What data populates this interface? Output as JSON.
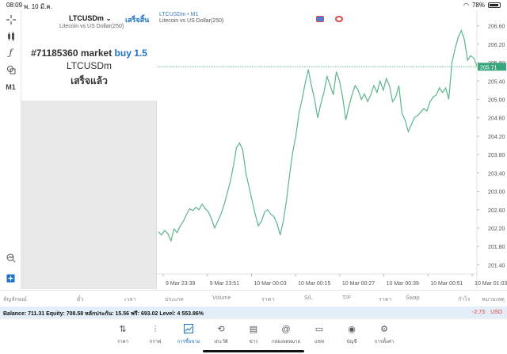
{
  "status": {
    "time": "08:09",
    "date": "พ. 10 มี.ค.",
    "battery": "78%"
  },
  "left_toolbar": {
    "timeframe": "M1",
    "tools": [
      "crosshair-icon",
      "indicators-icon",
      "function-icon",
      "objects-icon",
      "timeframe-label",
      "zoom-icon",
      "add-icon"
    ]
  },
  "trade": {
    "symbol": "LTCUSDm",
    "description": "Litecoin vs US Dollar(250)",
    "done_label": "เสร็จสิ้น",
    "order_prefix": "#71185360 market",
    "order_action": "buy 1.5",
    "order_symbol": "LTCUSDm",
    "order_status": "เสร็จแล้ว"
  },
  "chart": {
    "title": "LTCUSDm • M1",
    "subtitle": "Litecoin vs US Dollar(250)",
    "current_price_label": "205.71",
    "line_color": "#5bb58c",
    "price_line_color": "#3aa67d"
  },
  "chart_data": {
    "type": "line",
    "x_ticks": [
      "9 Mar 23:39",
      "9 Mar 23:51",
      "10 Mar 00:03",
      "10 Mar 00:15",
      "10 Mar 00:27",
      "10 Mar 00:39",
      "10 Mar 00:51",
      "10 Mar 01:03"
    ],
    "y_ticks": [
      "206.60",
      "206.20",
      "205.80",
      "205.40",
      "205.00",
      "204.60",
      "204.20",
      "203.80",
      "203.40",
      "203.00",
      "202.60",
      "202.20",
      "201.80",
      "201.40"
    ],
    "ylim": [
      201.2,
      206.8
    ],
    "current_price": 205.71,
    "values": [
      202.12,
      202.05,
      202.15,
      202.08,
      201.92,
      202.18,
      202.1,
      202.25,
      202.35,
      202.5,
      202.62,
      202.58,
      202.65,
      202.6,
      202.72,
      202.62,
      202.55,
      202.4,
      202.2,
      202.35,
      202.5,
      202.7,
      202.95,
      203.2,
      203.55,
      203.95,
      204.05,
      203.9,
      203.4,
      203.1,
      202.8,
      202.5,
      202.25,
      202.35,
      202.55,
      202.6,
      202.5,
      202.45,
      202.3,
      202.05,
      202.35,
      202.8,
      203.35,
      203.85,
      204.2,
      204.7,
      205.0,
      205.35,
      205.65,
      205.3,
      205.0,
      204.6,
      204.9,
      205.15,
      205.5,
      205.3,
      205.1,
      205.6,
      205.4,
      205.05,
      204.55,
      204.85,
      205.1,
      205.3,
      205.2,
      205.0,
      205.12,
      204.95,
      205.1,
      205.3,
      205.15,
      205.4,
      205.2,
      205.45,
      205.3,
      204.95,
      205.05,
      205.3,
      204.7,
      204.55,
      204.3,
      204.45,
      204.6,
      204.65,
      204.72,
      204.8,
      204.75,
      204.95,
      205.05,
      205.1,
      205.25,
      205.15,
      205.25,
      205.0,
      205.8,
      206.1,
      206.35,
      206.5,
      206.3,
      205.85,
      205.95,
      205.9,
      205.72
    ]
  },
  "table_header": [
    "สัญลักษณ์",
    "ตั๋ว",
    "เวลา",
    "ประเภท",
    "Volume",
    "ราคา",
    "S/L",
    "T/P",
    "ราคา",
    "Swap",
    "กำไร",
    "หมายเหตุ"
  ],
  "balance": {
    "text": "Balance: 711.31 Equity: 708.58 หลักประกัน: 15.56 ฟรี: 693.02 Level: 4 553.86%",
    "pl": "-2.73",
    "currency": "USD"
  },
  "nav": [
    {
      "icon": "quotes-icon",
      "label": "ราคา",
      "glyph": "⇅"
    },
    {
      "icon": "charts-icon",
      "label": "กราฟ",
      "glyph": "⫶"
    },
    {
      "icon": "trade-icon",
      "label": "การซื้อขาย",
      "glyph": "📈",
      "active": true
    },
    {
      "icon": "history-icon",
      "label": "ประวัติ",
      "glyph": "⟲"
    },
    {
      "icon": "news-icon",
      "label": "ข่าว",
      "glyph": "▤"
    },
    {
      "icon": "mailbox-icon",
      "label": "กล่องจดหมาย",
      "glyph": "@"
    },
    {
      "icon": "chat-icon",
      "label": "แชท",
      "glyph": "▭"
    },
    {
      "icon": "accounts-icon",
      "label": "บัญชี",
      "glyph": "◉"
    },
    {
      "icon": "settings-icon",
      "label": "การตั้งค่า",
      "glyph": "⚙"
    }
  ]
}
